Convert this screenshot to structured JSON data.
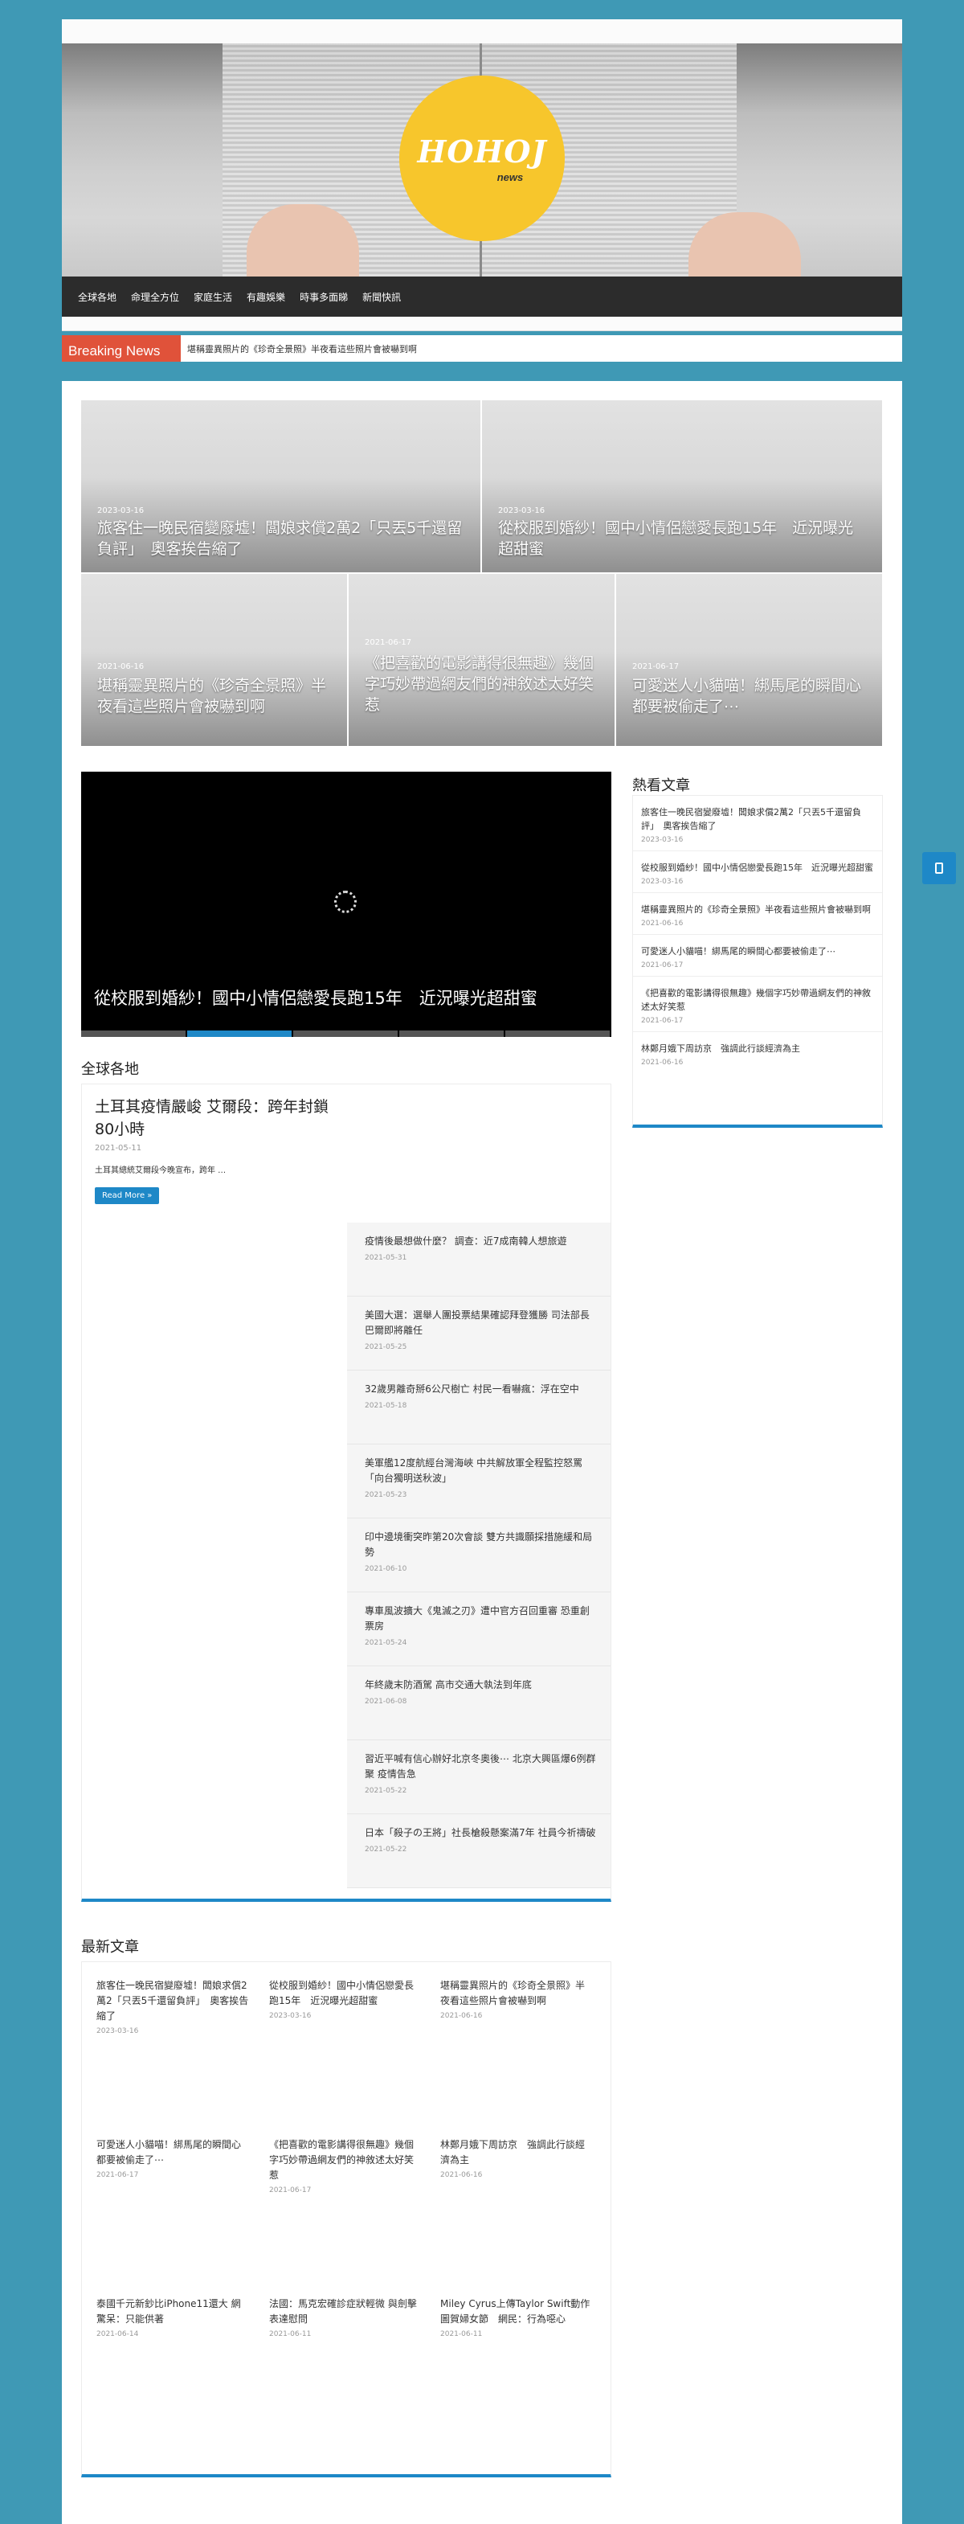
{
  "header": {
    "logo_main": "HOHOJ",
    "logo_sub": "news"
  },
  "nav": [
    "全球各地",
    "命理全方位",
    "家庭生活",
    "有趣娛樂",
    "時事多面睇",
    "新聞快訊"
  ],
  "ticker": {
    "label": "Breaking News",
    "text": "堪稱靈異照片的《珍奇全景照》半夜看這些照片會被嚇到啊"
  },
  "featured": [
    {
      "date": "2023-03-16",
      "title": "旅客住一晚民宿變廢墟！闆娘求償2萬2「只丟5千還留負評」　奧客挨告縮了"
    },
    {
      "date": "2023-03-16",
      "title": "從校服到婚紗！國中小情侶戀愛長跑15年　近況曝光超甜蜜"
    },
    {
      "date": "2021-06-16",
      "title": "堪稱靈異照片的《珍奇全景照》半夜看這些照片會被嚇到啊"
    },
    {
      "date": "2021-06-17",
      "title": "《把喜歡的電影講得很無趣》幾個字巧妙帶過網友們的神敘述太好笑惹"
    },
    {
      "date": "2021-06-17",
      "title": "可愛迷人小貓喵！綁馬尾的瞬間心都要被偷走了⋯"
    }
  ],
  "slider": {
    "title": "從校服到婚紗！國中小情侶戀愛長跑15年　近況曝光超甜蜜"
  },
  "hot": {
    "heading": "熱看文章",
    "items": [
      {
        "title": "旅客住一晚民宿變廢墟！闆娘求償2萬2「只丟5千還留負評」　奧客挨告縮了",
        "date": "2023-03-16"
      },
      {
        "title": "從校服到婚紗！國中小情侶戀愛長跑15年　近況曝光超甜蜜",
        "date": "2023-03-16"
      },
      {
        "title": "堪稱靈異照片的《珍奇全景照》半夜看這些照片會被嚇到啊",
        "date": "2021-06-16"
      },
      {
        "title": "可愛迷人小貓喵！綁馬尾的瞬間心都要被偷走了⋯",
        "date": "2021-06-17"
      },
      {
        "title": "《把喜歡的電影講得很無趣》幾個字巧妙帶過網友們的神敘述太好笑惹",
        "date": "2021-06-17"
      },
      {
        "title": "林鄭月娥下周訪京　強調此行談經濟為主",
        "date": "2021-06-16"
      }
    ]
  },
  "global": {
    "heading": "全球各地",
    "lead_title": "土耳其疫情嚴峻 艾爾段：跨年封鎖80小時",
    "lead_date": "2021-05-11",
    "lead_excerpt": "土耳其總統艾爾段今晚宣布，跨年 …",
    "read_more": "Read More »",
    "items": [
      {
        "title": "疫情後最想做什麼？ 調查：近7成南韓人想旅遊",
        "date": "2021-05-31"
      },
      {
        "title": "美國大選：選舉人團投票結果確認拜登獲勝 司法部長巴爾即將離任",
        "date": "2021-05-25"
      },
      {
        "title": "32歲男離奇掰6公尺樹亡 村民一看嚇瘋：浮在空中",
        "date": "2021-05-18"
      },
      {
        "title": "美軍艦12度航經台灣海峽 中共解放軍全程監控怒罵「向台獨明送秋波」",
        "date": "2021-05-23"
      },
      {
        "title": "印中邊境衝突昨第20次會談 雙方共識願採措施緩和局勢",
        "date": "2021-06-10"
      },
      {
        "title": "專車風波擴大《鬼滅之刃》遭中官方召回重審 恐重創票房",
        "date": "2021-05-24"
      },
      {
        "title": "年終歲末防酒駕 高市交通大執法到年底",
        "date": "2021-06-08"
      },
      {
        "title": "習近平喊有信心辦好北京冬奧後⋯ 北京大興區爆6例群聚 疫情告急",
        "date": "2021-05-22"
      },
      {
        "title": "日本「殺子の王將」社長槍殺懸案滿7年 社員今祈禱破",
        "date": "2021-05-22"
      }
    ]
  },
  "latest": {
    "heading": "最新文章",
    "items": [
      {
        "title": "旅客住一晚民宿變廢墟！闆娘求償2萬2「只丟5千還留負評」　奧客挨告縮了",
        "date": "2023-03-16"
      },
      {
        "title": "從校服到婚紗！國中小情侶戀愛長跑15年　近況曝光超甜蜜",
        "date": "2023-03-16"
      },
      {
        "title": "堪稱靈異照片的《珍奇全景照》半夜看這些照片會被嚇到啊",
        "date": "2021-06-16"
      },
      {
        "title": "可愛迷人小貓喵！綁馬尾的瞬間心都要被偷走了⋯",
        "date": "2021-06-17"
      },
      {
        "title": "《把喜歡的電影講得很無趣》幾個字巧妙帶過網友們的神敘述太好笑惹",
        "date": "2021-06-17"
      },
      {
        "title": "林鄭月娥下周訪京　強調此行談經濟為主",
        "date": "2021-06-16"
      },
      {
        "title": "泰國千元新鈔比iPhone11還大 網驚呆：只能供著",
        "date": "2021-06-14"
      },
      {
        "title": "法國：馬克宏確診症狀輕微 與劍擊表達慰問",
        "date": "2021-06-11"
      },
      {
        "title": "Miley Cyrus上傳Taylor Swift動作圖賀婦女節　網民：行為噁心",
        "date": "2021-06-11"
      }
    ]
  },
  "colors": {
    "background": "#3f99b5",
    "accent": "#1e88c7",
    "breaking": "#e0523a",
    "logo": "#f7c62c"
  }
}
